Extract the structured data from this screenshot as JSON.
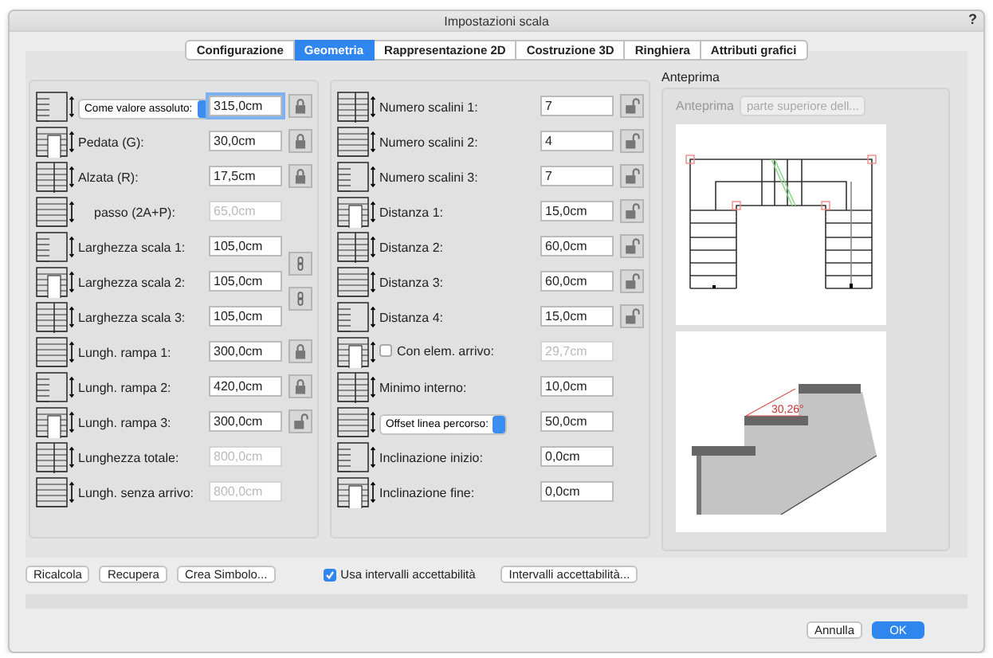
{
  "window": {
    "title": "Impostazioni scala",
    "help": "?"
  },
  "tabs": [
    {
      "label": "Configurazione",
      "selected": false
    },
    {
      "label": "Geometria",
      "selected": true
    },
    {
      "label": "Rappresentazione 2D",
      "selected": false
    },
    {
      "label": "Costruzione 3D",
      "selected": false
    },
    {
      "label": "Ringhiera",
      "selected": false
    },
    {
      "label": "Attributi grafici",
      "selected": false
    }
  ],
  "left_column": [
    {
      "kind": "select",
      "label": "Come valore assoluto:",
      "value": "315,0cm",
      "disabled": false,
      "focused": true,
      "locked": true
    },
    {
      "kind": "field",
      "label": "Pedata (G):",
      "value": "30,0cm",
      "disabled": false,
      "focused": false,
      "locked": true
    },
    {
      "kind": "field",
      "label": "Alzata (R):",
      "value": "17,5cm",
      "disabled": false,
      "focused": false,
      "locked": true
    },
    {
      "kind": "plain",
      "label": "passo (2A+P):",
      "value": "65,0cm",
      "disabled": true,
      "focused": false
    },
    {
      "kind": "field",
      "label": "Larghezza scala 1:",
      "value": "105,0cm",
      "disabled": false,
      "focused": false,
      "linked": true
    },
    {
      "kind": "field",
      "label": "Larghezza scala 2:",
      "value": "105,0cm",
      "disabled": false,
      "focused": false,
      "linked": true
    },
    {
      "kind": "field",
      "label": "Larghezza scala 3:",
      "value": "105,0cm",
      "disabled": false,
      "focused": false
    },
    {
      "kind": "field",
      "label": "Lungh. rampa 1:",
      "value": "300,0cm",
      "disabled": false,
      "focused": false,
      "locked": true
    },
    {
      "kind": "field",
      "label": "Lungh. rampa 2:",
      "value": "420,0cm",
      "disabled": false,
      "focused": false,
      "locked": true
    },
    {
      "kind": "field",
      "label": "Lungh. rampa 3:",
      "value": "300,0cm",
      "disabled": false,
      "focused": false,
      "locked": false
    },
    {
      "kind": "field",
      "label": "Lunghezza totale:",
      "value": "800,0cm",
      "disabled": true,
      "focused": false
    },
    {
      "kind": "field",
      "label": "Lungh. senza arrivo:",
      "value": "800,0cm",
      "disabled": true,
      "focused": false
    }
  ],
  "middle_column": [
    {
      "kind": "field",
      "label": "Numero scalini 1:",
      "value": "7",
      "disabled": false,
      "focused": false,
      "locked": false
    },
    {
      "kind": "field",
      "label": "Numero scalini 2:",
      "value": "4",
      "disabled": false,
      "focused": false,
      "locked": false
    },
    {
      "kind": "field",
      "label": "Numero scalini 3:",
      "value": "7",
      "disabled": false,
      "focused": false,
      "locked": false
    },
    {
      "kind": "field",
      "label": "Distanza 1:",
      "value": "15,0cm",
      "disabled": false,
      "focused": false,
      "locked": false
    },
    {
      "kind": "field",
      "label": "Distanza 2:",
      "value": "60,0cm",
      "disabled": false,
      "focused": false,
      "locked": false
    },
    {
      "kind": "field",
      "label": "Distanza 3:",
      "value": "60,0cm",
      "disabled": false,
      "focused": false,
      "locked": false
    },
    {
      "kind": "field",
      "label": "Distanza 4:",
      "value": "15,0cm",
      "disabled": false,
      "focused": false,
      "locked": false
    },
    {
      "kind": "check",
      "label": "Con elem. arrivo:",
      "checked": false,
      "value": "29,7cm",
      "disabled": true,
      "focused": false
    },
    {
      "kind": "field",
      "label": "Minimo interno:",
      "value": "10,0cm",
      "disabled": false,
      "focused": false
    },
    {
      "kind": "select",
      "label": "Offset linea percorso:",
      "value": "50,0cm",
      "disabled": false,
      "focused": false
    },
    {
      "kind": "field",
      "label": "Inclinazione inizio:",
      "value": "0,0cm",
      "disabled": false,
      "focused": false
    },
    {
      "kind": "field",
      "label": "Inclinazione fine:",
      "value": "0,0cm",
      "disabled": false,
      "focused": false
    }
  ],
  "preview": {
    "title": "Anteprima",
    "label": "Anteprima",
    "select": "parte superiore dell...",
    "angle_label": "30,26°"
  },
  "actions": [
    {
      "kind": "button",
      "label": "Ricalcola"
    },
    {
      "kind": "button",
      "label": "Recupera"
    },
    {
      "kind": "button",
      "label": "Crea Simbolo..."
    },
    {
      "kind": "check",
      "label": "Usa intervalli accettabilità",
      "checked": true
    },
    {
      "kind": "button",
      "label": "Intervalli accettabilità..."
    }
  ],
  "footer": [
    {
      "label": "Annulla",
      "default": false
    },
    {
      "label": "OK",
      "default": true
    }
  ]
}
